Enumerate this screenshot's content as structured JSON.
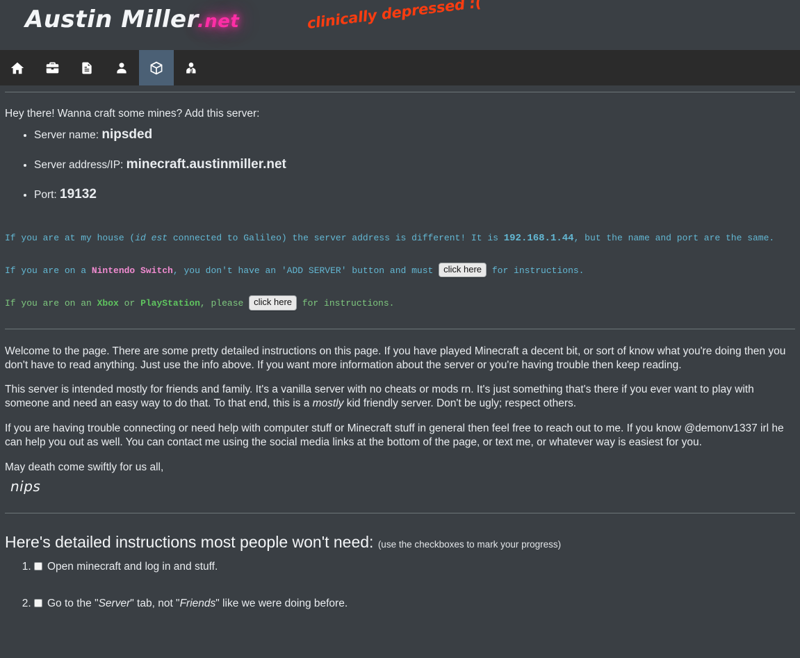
{
  "header": {
    "logo_main": "Austin Miller",
    "logo_tld": ".net",
    "tagline": "clinically depressed :(",
    "logo_pink_hex": "#ff2ea6",
    "tagline_hex": "#fa3c10"
  },
  "nav": {
    "active_index": 4,
    "active_bg_hex": "#4b6075",
    "bar_bg_hex": "#2b2b2b",
    "items": [
      {
        "icon": "home-icon",
        "name": "nav-item-home"
      },
      {
        "icon": "briefcase-icon",
        "name": "nav-item-work"
      },
      {
        "icon": "document-icon",
        "name": "nav-item-resume"
      },
      {
        "icon": "person-icon",
        "name": "nav-item-about"
      },
      {
        "icon": "cube-icon",
        "name": "nav-item-minecraft"
      },
      {
        "icon": "person-tie-icon",
        "name": "nav-item-contact"
      }
    ]
  },
  "server": {
    "lead": "Hey there! Wanna craft some mines? Add this server:",
    "items": [
      {
        "label": "Server name:",
        "value": "nipsded"
      },
      {
        "label": "Server address/IP:",
        "value": "minecraft.austinmiller.net"
      },
      {
        "label": "Port:",
        "value": "19132"
      }
    ]
  },
  "notes": {
    "house": {
      "pre": "If you are at my house (",
      "italic": "id est",
      "mid": " connected to Galileo) the server address is different! It is ",
      "ip": "192.168.1.44",
      "post": ", but the name and port are the same."
    },
    "switch": {
      "pre": "If you are on a ",
      "platform": "Nintendo Switch",
      "mid": ", you don't have an 'ADD SERVER' button and must ",
      "button": "click here",
      "post": " for instructions."
    },
    "console": {
      "pre": "If you are on an ",
      "platform_a": "Xbox",
      "conj": " or ",
      "platform_b": "PlayStation",
      "mid": ", please ",
      "button": "click here",
      "post": " for instructions."
    }
  },
  "body": {
    "p1": "Welcome to the page. There are some pretty detailed instructions on this page. If you have played Minecraft a decent bit, or sort of know what you're doing then you don't have to read anything. Just use the info above. If you want more information about the server or you're having trouble then keep reading.",
    "p2_a": "This server is intended mostly for friends and family. It's a vanilla server with no cheats or mods rn. It's just something that's there if you ever want to play with someone and need an easy way to do that. To that end, this is a ",
    "p2_em": "mostly",
    "p2_b": " kid friendly server. Don't be ugly; respect others.",
    "p3": "If you are having trouble connecting or need help with computer stuff or Minecraft stuff in general then feel free to reach out to me. If you know @demonv1337 irl he can help you out as well. You can contact me using the social media links at the bottom of the page, or text me, or whatever way is easiest for you.",
    "signoff": "May death come swiftly for us all,",
    "signature": "nips"
  },
  "instructions": {
    "title": "Here's detailed instructions most people won't need:",
    "hint": "(use the checkboxes to mark your progress)",
    "steps": [
      {
        "pre": "Open minecraft and log in and stuff.",
        "em1": "",
        "mid": "",
        "em2": "",
        "post": "",
        "checked": false
      },
      {
        "pre": "Go to the \"",
        "em1": "Server",
        "mid": "\" tab, not \"",
        "em2": "Friends",
        "post": "\" like we were doing before.",
        "checked": false
      }
    ]
  }
}
